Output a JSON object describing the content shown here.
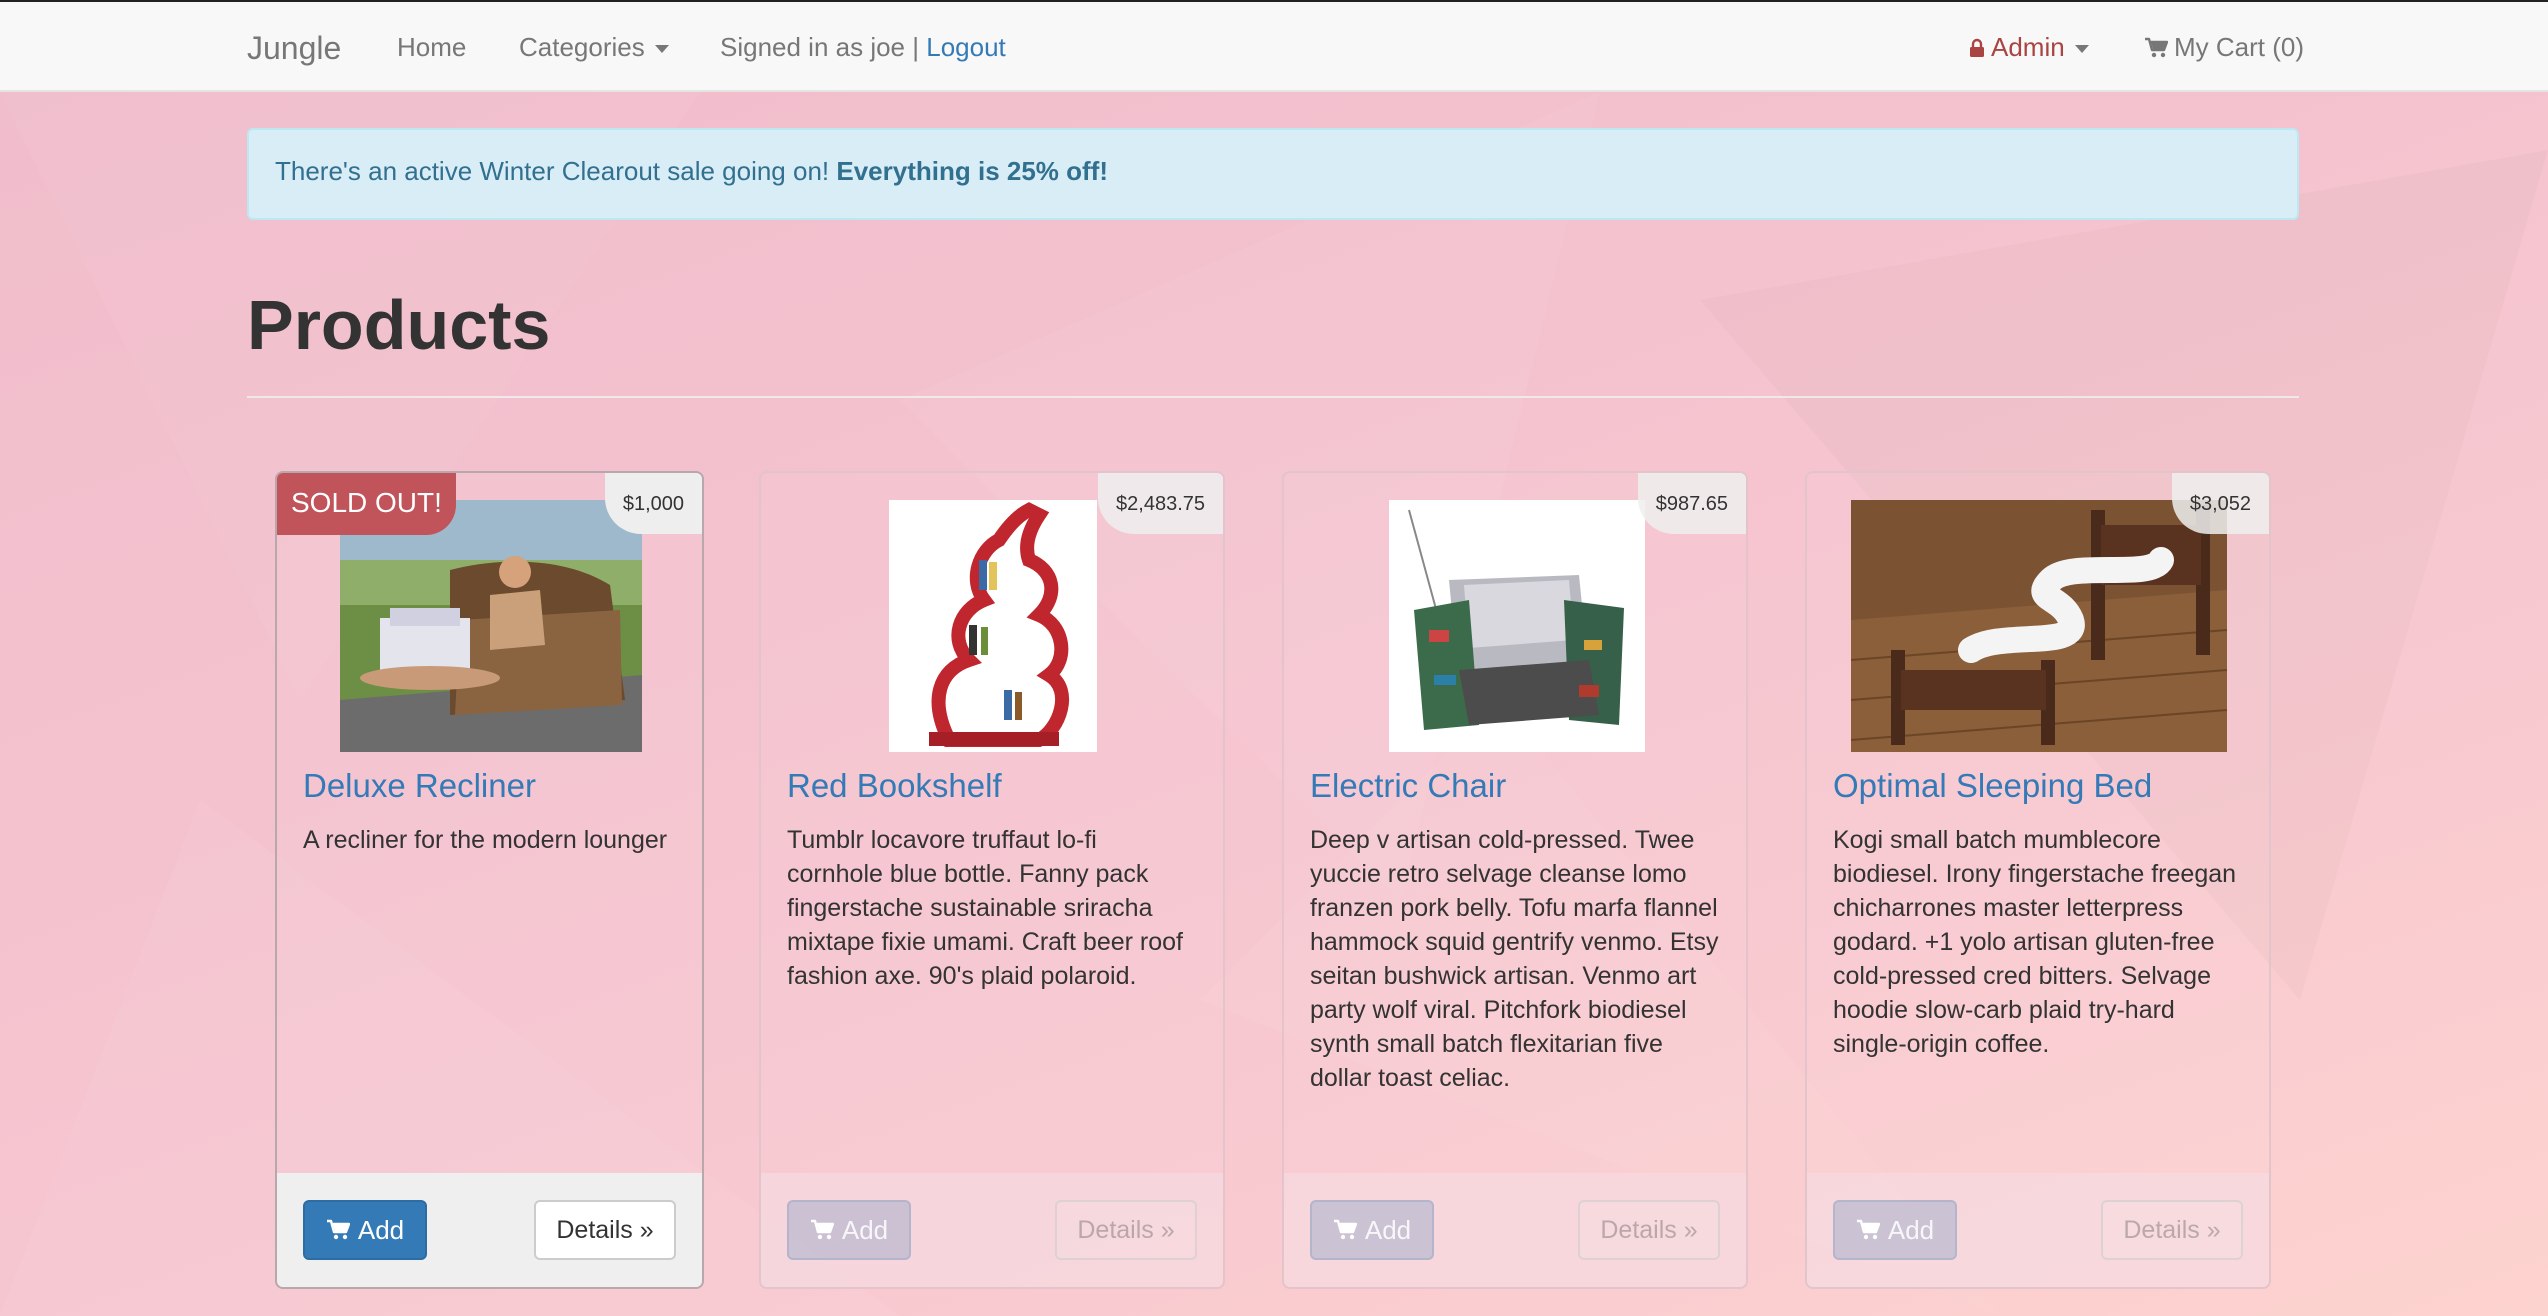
{
  "navbar": {
    "brand": "Jungle",
    "home": "Home",
    "categories": "Categories",
    "signed_in_text": "Signed in as joe |",
    "logout": "Logout",
    "admin": "Admin",
    "cart": "My Cart (0)"
  },
  "alert": {
    "text": "There's an active Winter Clearout sale going on!",
    "emphasis": "Everything is 25% off!"
  },
  "page": {
    "title": "Products"
  },
  "products": [
    {
      "name": "Deluxe Recliner",
      "price": "$1,000",
      "badge": "SOLD OUT!",
      "description": "A recliner for the modern lounger",
      "add_label": "Add",
      "details_label": "Details »"
    },
    {
      "name": "Red Bookshelf",
      "price": "$2,483.75",
      "description": "Tumblr locavore truffaut lo-fi cornhole blue bottle. Fanny pack fingerstache sustainable sriracha mixtape fixie umami. Craft beer roof fashion axe. 90's plaid polaroid.",
      "add_label": "Add",
      "details_label": "Details »"
    },
    {
      "name": "Electric Chair",
      "price": "$987.65",
      "description": "Deep v artisan cold-pressed. Twee yuccie retro selvage cleanse lomo franzen pork belly. Tofu marfa flannel hammock squid gentrify venmo. Etsy seitan bushwick artisan. Venmo art party wolf viral. Pitchfork biodiesel synth small batch flexitarian five dollar toast celiac.",
      "add_label": "Add",
      "details_label": "Details »"
    },
    {
      "name": "Optimal Sleeping Bed",
      "price": "$3,052",
      "description": "Kogi small batch mumblecore biodiesel. Irony fingerstache freegan chicharrones master letterpress godard. +1 yolo artisan gluten-free cold-pressed cred bitters. Selvage hoodie slow-carb plaid try-hard single-origin coffee.",
      "add_label": "Add",
      "details_label": "Details »"
    }
  ],
  "colors": {
    "primary": "#337ab7",
    "danger": "#c0545a",
    "info_bg": "#d9edf7",
    "info_text": "#31708f"
  }
}
